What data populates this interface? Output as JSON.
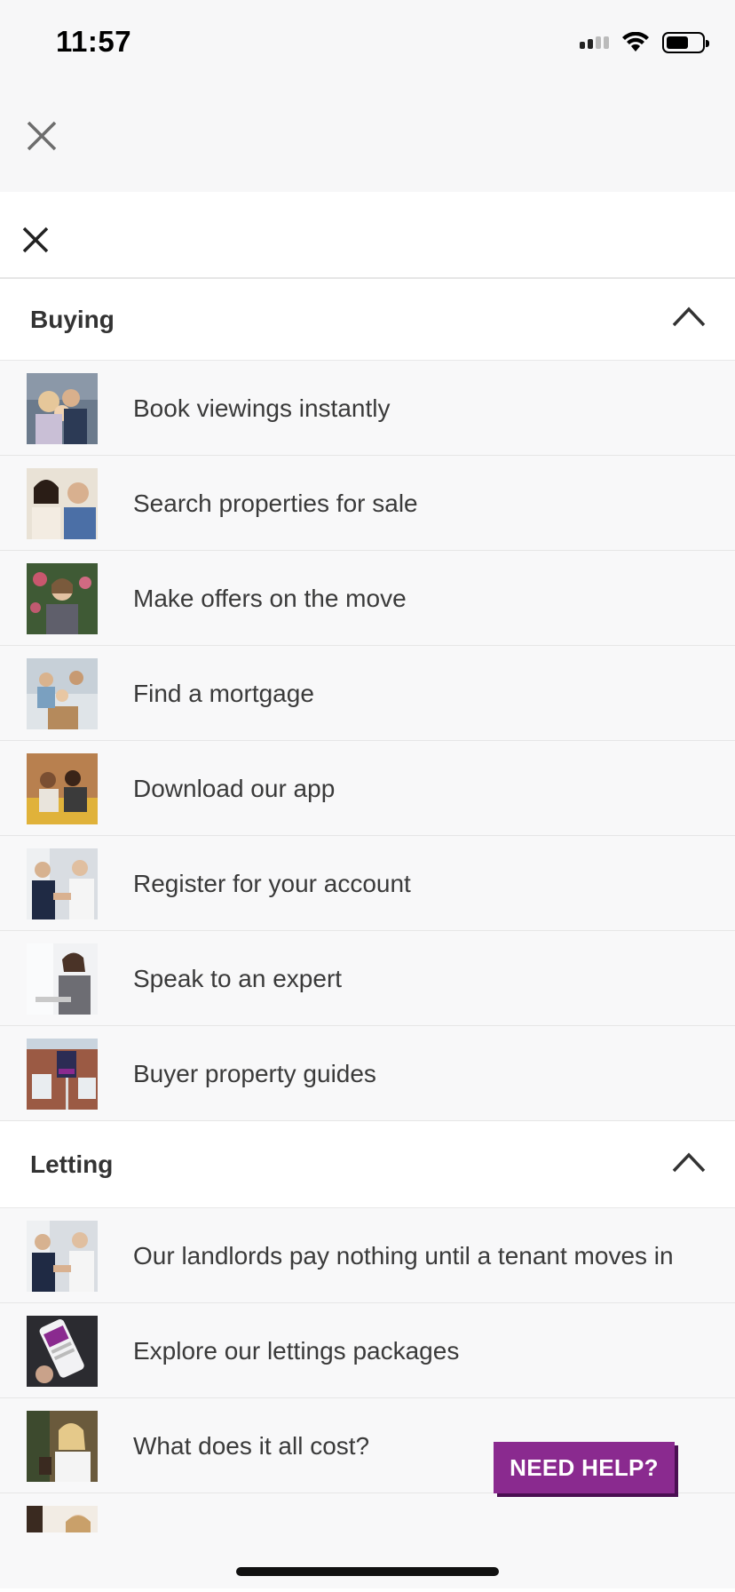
{
  "status_bar": {
    "time": "11:57"
  },
  "outer_close_icon": "close-icon",
  "inner_close_icon": "close-icon",
  "sections": [
    {
      "title": "Buying",
      "expanded": true,
      "items": [
        {
          "label": "Book viewings instantly",
          "thumb": "family-photo"
        },
        {
          "label": "Search properties for sale",
          "thumb": "couple-photo"
        },
        {
          "label": "Make offers on the move",
          "thumb": "woman-garden-photo"
        },
        {
          "label": "Find a mortgage",
          "thumb": "family-boxes-photo"
        },
        {
          "label": "Download our app",
          "thumb": "couple-sofa-photo"
        },
        {
          "label": "Register for your account",
          "thumb": "handshake-photo"
        },
        {
          "label": "Speak to an expert",
          "thumb": "woman-desk-photo"
        },
        {
          "label": "Buyer property guides",
          "thumb": "for-sale-sign-photo"
        }
      ]
    },
    {
      "title": "Letting",
      "expanded": true,
      "items": [
        {
          "label": "Our landlords pay nothing until a tenant moves in",
          "thumb": "handshake-photo"
        },
        {
          "label": "Explore our lettings packages",
          "thumb": "phone-app-photo"
        },
        {
          "label": "What does it all cost?",
          "thumb": "woman-portrait-photo"
        }
      ]
    }
  ],
  "need_help": {
    "label": "NEED HELP?"
  },
  "colors": {
    "accent": "#8a2a8f",
    "background": "#f8f8f9",
    "text": "#333333"
  }
}
